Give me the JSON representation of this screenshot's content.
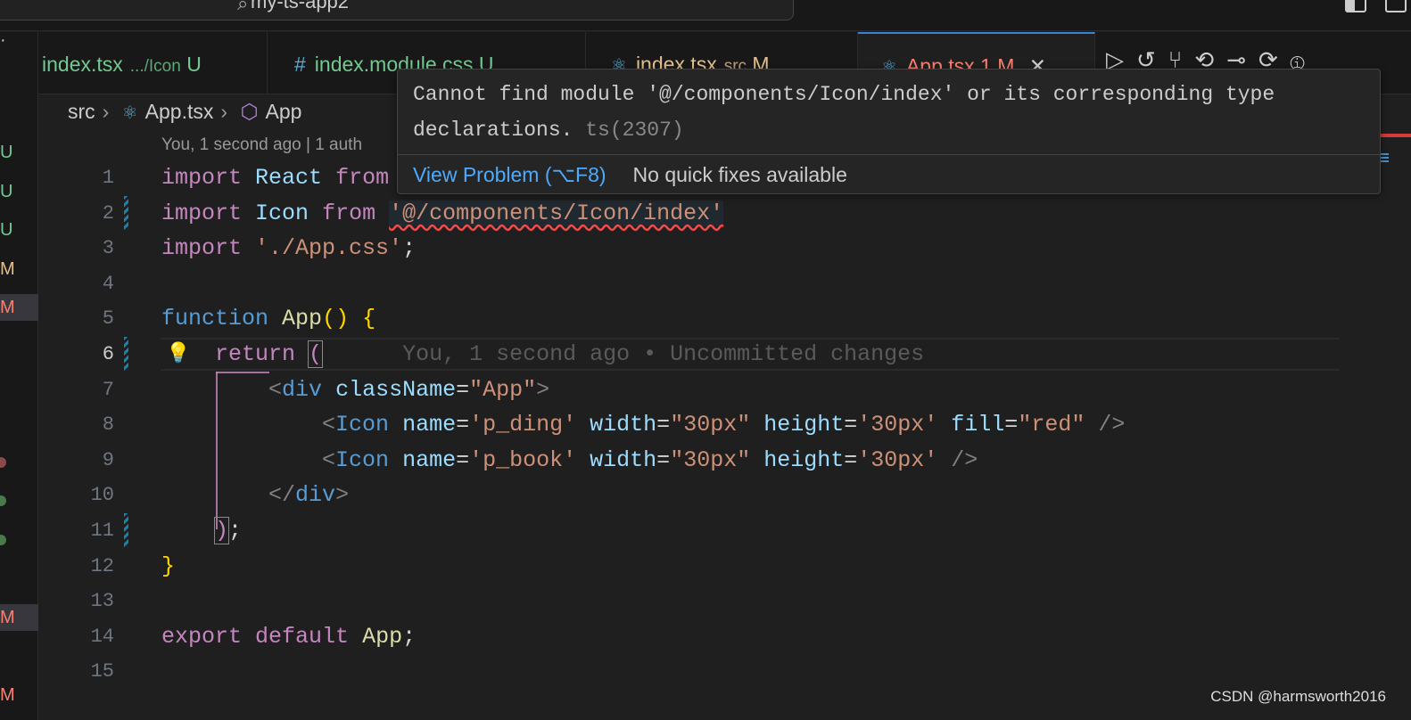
{
  "titlebar": {
    "search_text": "my-ts-app2"
  },
  "tabs": [
    {
      "label": "index.tsx",
      "sub": ".../Icon",
      "status": "U",
      "color": "#73c991"
    },
    {
      "label": "index.module.css",
      "sub": "",
      "status": "U",
      "color": "#73c991"
    },
    {
      "label": "index.tsx",
      "sub": "src",
      "status": "M",
      "color": "#e2c08d"
    },
    {
      "label": "App.tsx",
      "sub": "1",
      "status": "M",
      "color": "#f88070"
    }
  ],
  "breadcrumb": [
    "src",
    "App.tsx",
    "App"
  ],
  "blame": "You, 1 second ago | 1 auth",
  "gutter_status": [
    "U",
    "U",
    "U",
    "M",
    "M",
    "M",
    "M"
  ],
  "code_lines": [
    "1",
    "2",
    "3",
    "4",
    "5",
    "6",
    "7",
    "8",
    "9",
    "10",
    "11",
    "12",
    "13",
    "14",
    "15"
  ],
  "code": {
    "l1": [
      "import",
      "React",
      "from"
    ],
    "l2": [
      "import",
      "Icon",
      "from",
      "'@/components/Icon/index'"
    ],
    "l3": [
      "import",
      "'./App.css'",
      ";"
    ],
    "l5": [
      "function",
      "App",
      "()",
      "{"
    ],
    "l6": [
      "return",
      "(",
      "You, 1 second ago • Uncommitted changes"
    ],
    "l7": [
      "<",
      "div",
      "className",
      "=",
      "\"App\"",
      ">"
    ],
    "l8": [
      "<",
      "Icon",
      "name",
      "=",
      "'p_ding'",
      "width",
      "=",
      "\"30px\"",
      "height",
      "=",
      "'30px'",
      "fill",
      "=",
      "\"red\"",
      "/>"
    ],
    "l9": [
      "<",
      "Icon",
      "name",
      "=",
      "'p_book'",
      "width",
      "=",
      "\"30px\"",
      "height",
      "=",
      "'30px'",
      "/>"
    ],
    "l10": [
      "</",
      "div",
      ">"
    ],
    "l11": [
      ")",
      ";"
    ],
    "l12": [
      "}"
    ],
    "l14": [
      "export",
      "default",
      "App",
      ";"
    ]
  },
  "hover": {
    "message": "Cannot find module '@/components/Icon/index' or its corresponding type declarations.",
    "code": "ts(2307)",
    "view_problem": "View Problem (⌥F8)",
    "no_fixes": "No quick fixes available"
  },
  "watermark": "CSDN @harmsworth2016"
}
